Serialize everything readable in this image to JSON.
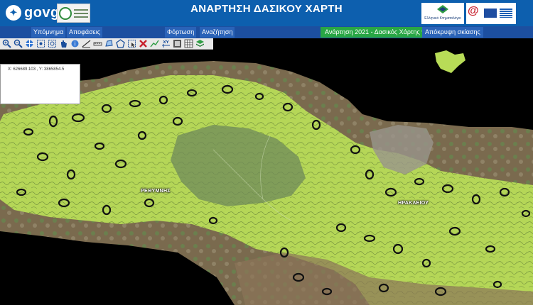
{
  "header": {
    "gov_logo_text": "govgr",
    "title": "ΑΝΑΡΤΗΣΗ ΔΑΣΙΚΟΥ ΧΑΡΤΗ",
    "cadastre_caption": "Ελληνικό Κτηματολόγιο"
  },
  "nav": {
    "legend": "Υπόμνημα",
    "decisions": "Αποφάσεις",
    "load": "Φόρτωση",
    "search": "Αναζήτηση",
    "posting": "Ανάρτηση 2021 - Δασικός Χάρτης",
    "hide_shading": "Απόκρυψη σκίασης"
  },
  "toolbar": {
    "tools": [
      "zoom-in-icon",
      "zoom-out-icon",
      "full-extent-icon",
      "zoom-box-icon",
      "zoom-selection-icon",
      "pan-icon",
      "identify-icon",
      "measure-distance-icon",
      "measure-angle-icon",
      "measure-area-icon",
      "select-polygon-icon",
      "select-rectangle-icon",
      "clear-selection-icon",
      "draw-line-icon",
      "xy-coordinates-icon",
      "print-icon",
      "basemap-icon",
      "layers-icon"
    ]
  },
  "coords": {
    "text": "Χ: 626689.103 , Υ: 3865854.5"
  },
  "map": {
    "labels": {
      "rethymno": "ΡΕΘΥΜΝΗΣ",
      "heraklion": "ΗΡΑΚΛΕΙΟΥ"
    },
    "colors": {
      "sea": "#000000",
      "forest_overlay": "#b8dc57",
      "terrain": "#6f8454",
      "outline": "#111111"
    }
  },
  "colors": {
    "header": "#0d5fae",
    "navbar": "#1c4fa0",
    "posting_button": "#28a745"
  }
}
